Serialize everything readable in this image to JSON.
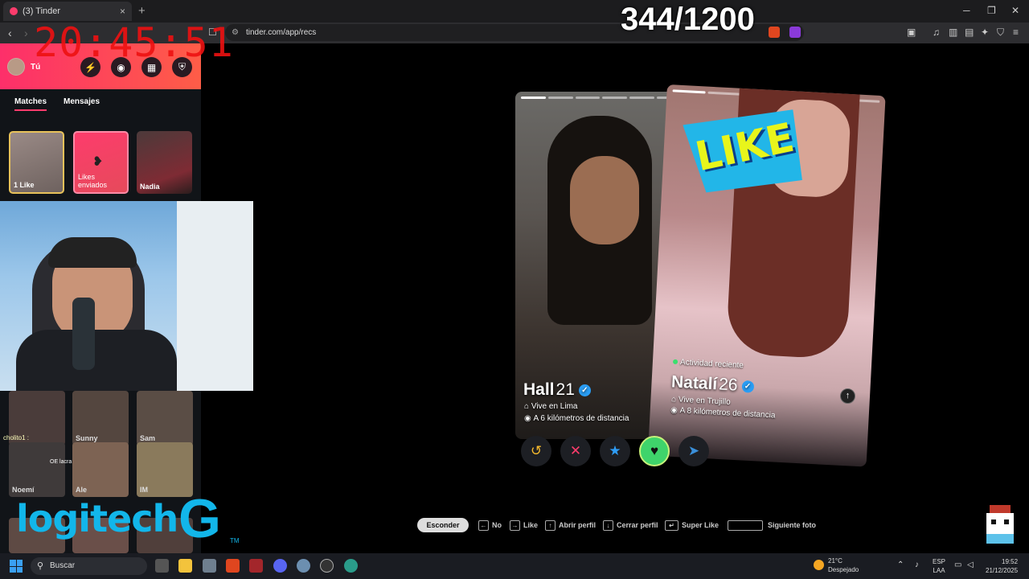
{
  "browser": {
    "tab_title": "(3) Tinder",
    "tab_close": "×",
    "new_tab": "+",
    "url": "tinder.com/app/recs",
    "window_controls": [
      "─",
      "❐",
      "✕"
    ]
  },
  "overlay": {
    "clock": "20:45:51",
    "counter": "344/1200"
  },
  "sidebar": {
    "user_label": "Tú",
    "tabs": [
      "Matches",
      "Mensajes"
    ],
    "match_cards": [
      {
        "label": "1 Like"
      },
      {
        "label": "Likes enviados"
      },
      {
        "label": "Nadia"
      }
    ],
    "grid_names": [
      "Sunny",
      "Sam",
      "Noemí",
      "Ale",
      "IM"
    ],
    "chat": [
      {
        "user": "cholito1 :",
        "text": ""
      },
      {
        "user": "",
        "text": "OE lacra"
      }
    ]
  },
  "cards": [
    {
      "name": "Hall",
      "age": "21",
      "verified": true,
      "lives": "Vive en Lima",
      "distance": "A 6 kilómetros de distancia"
    },
    {
      "name": "Natalí",
      "age": "26",
      "verified": true,
      "activity": "Actividad reciente",
      "lives": "Vive en Trujillo",
      "distance": "A 8 kilómetros de distancia",
      "stamp": "LIKE"
    }
  ],
  "actions": [
    {
      "name": "rewind",
      "icon": "↺",
      "color": "#f5b92c"
    },
    {
      "name": "nope",
      "icon": "✕",
      "color": "#fd3c6c"
    },
    {
      "name": "super-like",
      "icon": "★",
      "color": "#2e9df5"
    },
    {
      "name": "like",
      "icon": "♥",
      "color": "#3fd46b"
    },
    {
      "name": "boost",
      "icon": "➤",
      "color": "#3a8fd9"
    }
  ],
  "shortcuts": {
    "hide": "Esconder",
    "items": [
      {
        "key": "←",
        "label": "No"
      },
      {
        "key": "→",
        "label": "Like"
      },
      {
        "key": "↑",
        "label": "Abrir perfil"
      },
      {
        "key": "↓",
        "label": "Cerrar perfil"
      },
      {
        "key": "↵",
        "label": "Super Like"
      },
      {
        "key": "",
        "label": "Siguiente foto"
      }
    ]
  },
  "branding": {
    "logo_text": "logitech",
    "logo_g": "G",
    "logo_tm": "TM"
  },
  "taskbar": {
    "search_placeholder": "Buscar",
    "weather_temp": "21°C",
    "weather_desc": "Despejado",
    "lang_top": "ESP",
    "lang_bottom": "LAA",
    "time": "19:52",
    "date": "21/12/2025"
  },
  "colors": {
    "tinder_gradient_start": "#fd2f6a",
    "tinder_gradient_end": "#fe5d47",
    "verified_blue": "#2a9df4",
    "like_green": "#3fd46b",
    "logitech_blue": "#12b6ea"
  }
}
